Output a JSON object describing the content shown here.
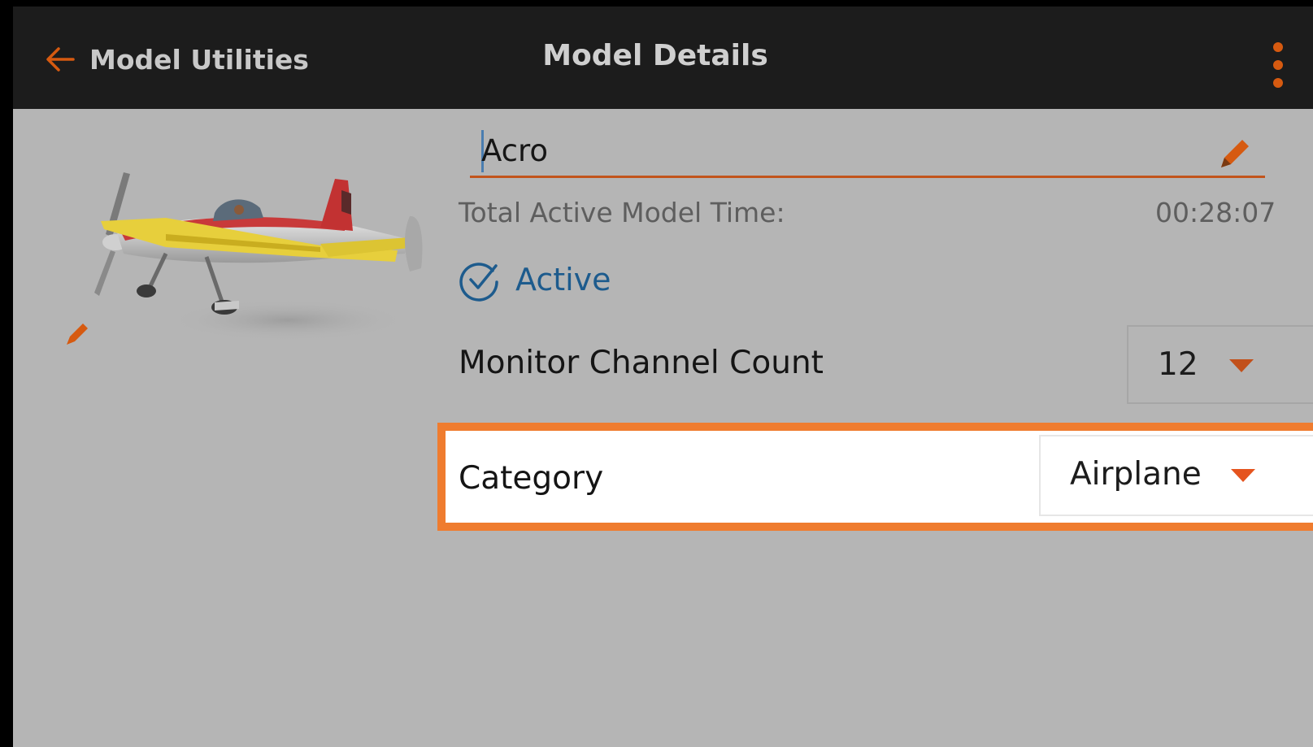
{
  "header": {
    "back_label": "Model Utilities",
    "title": "Model Details",
    "back_icon": "arrow-left-icon",
    "menu_icon": "kebab-menu-icon"
  },
  "model": {
    "name": "Acro",
    "name_edit_icon": "pencil-icon",
    "image_edit_icon": "pencil-icon",
    "image": "airplane-model-image",
    "time_label": "Total Active Model Time:",
    "time_value": "00:28:07",
    "active_label": "Active",
    "active_checked": true
  },
  "settings": {
    "channel_count_label": "Monitor Channel Count",
    "channel_count_value": "12",
    "category_label": "Category",
    "category_value": "Airplane"
  },
  "colors": {
    "accent_orange": "#e5541e",
    "highlight_border": "#ef7c2f",
    "active_blue": "#1d5b8d",
    "topbar_bg": "#1c1c1c",
    "content_bg": "#b5b5b5"
  }
}
